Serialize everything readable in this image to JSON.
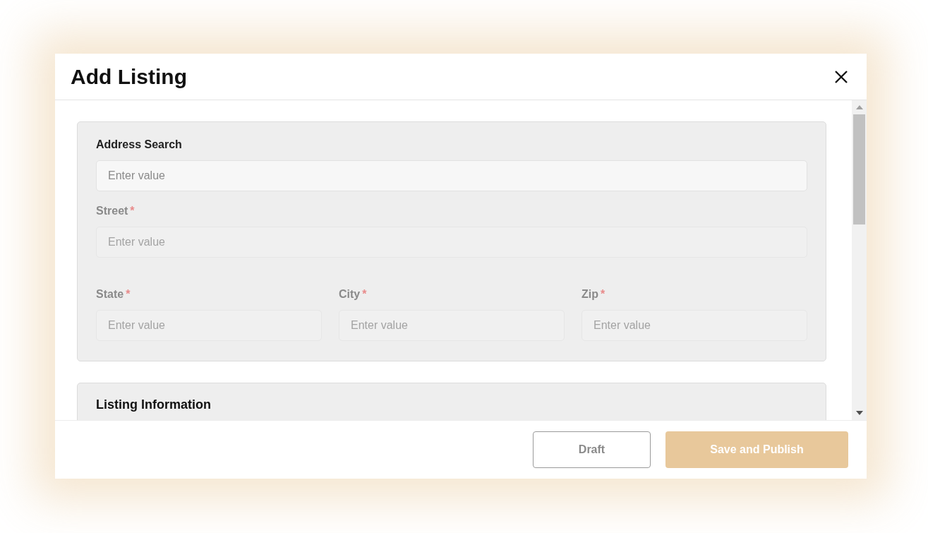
{
  "dialog": {
    "title": "Add Listing"
  },
  "sections": [
    {
      "rows": [
        [
          {
            "label": "Address Search",
            "placeholder": "Enter value",
            "disabled": false
          }
        ],
        [
          {
            "label": "Street",
            "required_mark": "*",
            "placeholder": "Enter value",
            "disabled": true
          }
        ],
        [
          {
            "label": "State",
            "required_mark": "*",
            "placeholder": "Enter value",
            "disabled": true
          },
          {
            "label": "City",
            "required_mark": "*",
            "placeholder": "Enter value",
            "disabled": true
          },
          {
            "label": "Zip",
            "required_mark": "*",
            "placeholder": "Enter value",
            "disabled": true
          }
        ]
      ]
    },
    {
      "title": "Listing Information"
    }
  ],
  "buttons": [
    {
      "label": "Draft",
      "kind": "outline",
      "disabled": false
    },
    {
      "label": "Save and Publish",
      "kind": "primary",
      "disabled": true
    }
  ]
}
